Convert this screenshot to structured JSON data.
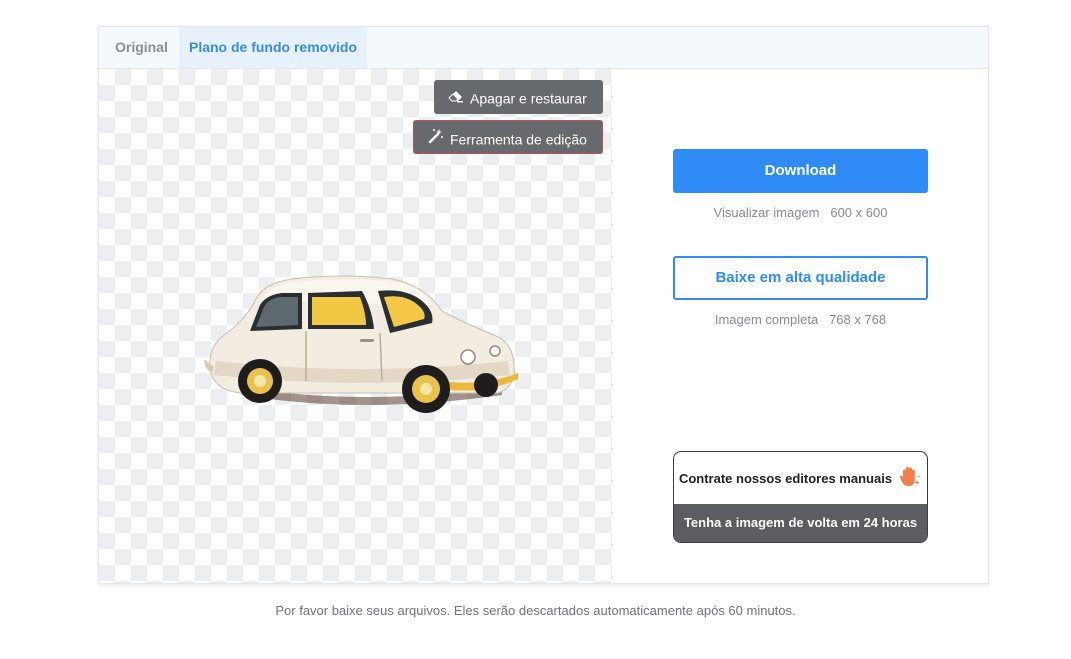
{
  "tabs": [
    {
      "label": "Original",
      "active": false
    },
    {
      "label": "Plano de fundo removido",
      "active": true
    }
  ],
  "preview": {
    "tools": {
      "erase_label": "Apagar e restaurar",
      "edit_label": "Ferramenta de edição"
    },
    "image_subject": "white vintage car with transparent background"
  },
  "actions": {
    "download_label": "Download",
    "preview_info": "Visualizar imagem   600 x 600",
    "hq_label": "Baixe em alta qualidade",
    "full_info": "Imagem completa   768 x 768"
  },
  "hire": {
    "title": "Contrate nossos editores manuais",
    "subtitle": "Tenha a imagem de volta em 24 horas"
  },
  "footer": {
    "note": "Por favor baixe seus arquivos. Eles serão descartados automaticamente após 60 minutos."
  },
  "colors": {
    "accent": "#2f8cf7",
    "tool_bg": "#666a6e",
    "tab_active_bg": "#e6f1fc",
    "hire_footer_bg": "#5b5d60"
  }
}
